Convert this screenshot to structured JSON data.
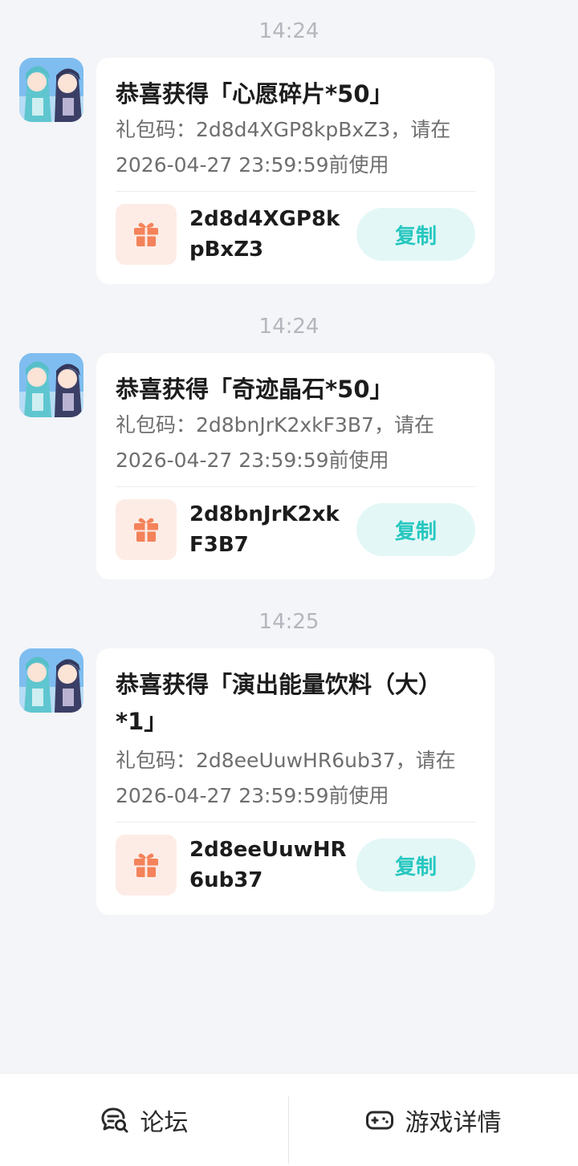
{
  "messages": [
    {
      "time": "14:24",
      "title": "恭喜获得「心愿碎片*50」",
      "desc": "礼包码：2d8d4XGP8kpBxZ3，请在2026-04-27 23:59:59前使用",
      "code": "2d8d4XGP8kpBxZ3",
      "copy_label": "复制"
    },
    {
      "time": "14:24",
      "title": "恭喜获得「奇迹晶石*50」",
      "desc": "礼包码：2d8bnJrK2xkF3B7，请在2026-04-27 23:59:59前使用",
      "code": "2d8bnJrK2xkF3B7",
      "copy_label": "复制"
    },
    {
      "time": "14:25",
      "title": "恭喜获得「演出能量饮料（大）*1」",
      "desc": "礼包码：2d8eeUuwHR6ub37，请在2026-04-27 23:59:59前使用",
      "code": "2d8eeUuwHR6ub37",
      "copy_label": "复制"
    }
  ],
  "bottom_nav": {
    "forum_label": "论坛",
    "forum_icon": "chat-bubble-search-icon",
    "game_label": "游戏详情",
    "game_icon": "gamepad-icon"
  },
  "colors": {
    "accent": "#27c7c0",
    "gift": "#f4825a",
    "background": "#f4f5f8"
  }
}
